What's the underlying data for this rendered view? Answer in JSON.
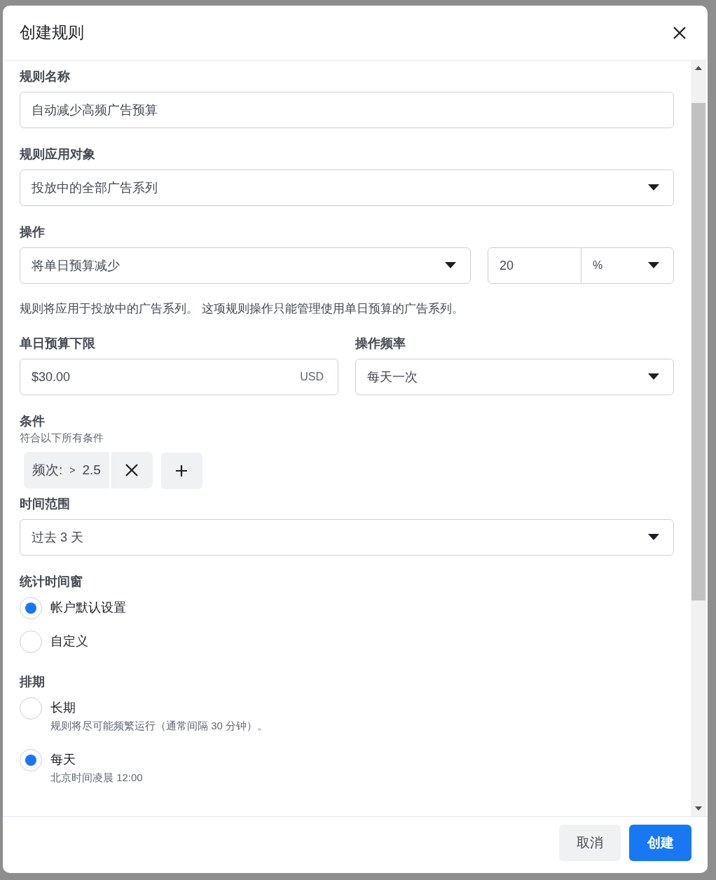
{
  "dialog": {
    "title": "创建规则"
  },
  "rule_name": {
    "label": "规则名称",
    "value": "自动减少高频广告预算"
  },
  "apply_to": {
    "label": "规则应用对象",
    "value": "投放中的全部广告系列"
  },
  "action": {
    "label": "操作",
    "value": "将单日预算减少",
    "amount": "20",
    "unit": "%"
  },
  "action_note": "规则将应用于投放中的广告系列。 这项规则操作只能管理使用单日预算的广告系列。",
  "min_budget": {
    "label": "单日预算下限",
    "value": "$30.00",
    "currency": "USD"
  },
  "frequency": {
    "label": "操作频率",
    "value": "每天一次"
  },
  "conditions": {
    "label": "条件",
    "hint": "符合以下所有条件",
    "items": [
      {
        "metric": "频次:",
        "operator": ">",
        "value": "2.5"
      }
    ]
  },
  "time_range": {
    "label": "时间范围",
    "value": "过去 3 天"
  },
  "attribution": {
    "label": "统计时间窗",
    "options": [
      {
        "label": "帐户默认设置",
        "selected": true
      },
      {
        "label": "自定义",
        "selected": false
      }
    ]
  },
  "schedule": {
    "label": "排期",
    "options": [
      {
        "label": "长期",
        "description": "规则将尽可能频繁运行（通常间隔 30 分钟）。",
        "selected": false
      },
      {
        "label": "每天",
        "description": "北京时间凌晨 12:00",
        "selected": true
      }
    ]
  },
  "buttons": [
    {
      "label": "取消",
      "kind": "secondary"
    },
    {
      "label": "创建",
      "kind": "primary"
    }
  ]
}
